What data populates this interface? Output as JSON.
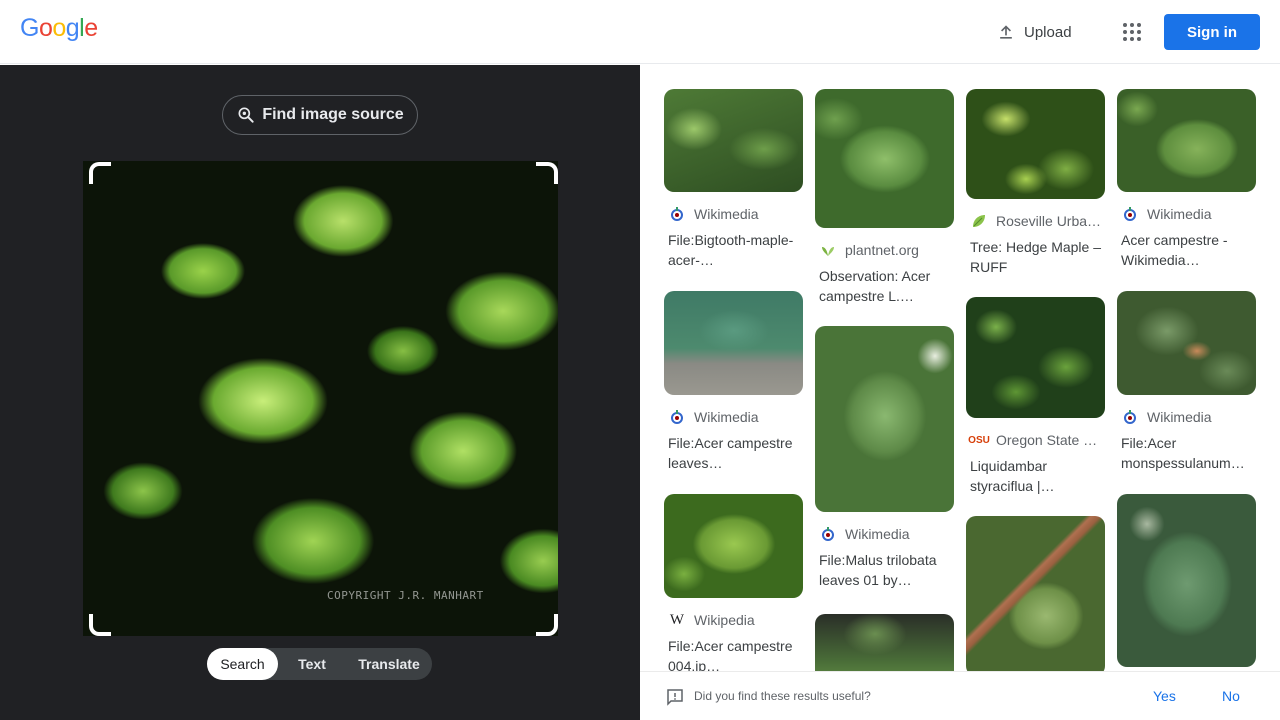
{
  "header": {
    "logo": {
      "letters": [
        "G",
        "o",
        "o",
        "g",
        "l",
        "e"
      ],
      "colors": [
        "#4285F4",
        "#EA4335",
        "#FBBC05",
        "#4285F4",
        "#34A853",
        "#EA4335"
      ]
    },
    "upload_label": "Upload",
    "signin_label": "Sign in",
    "signin_color": "#1a73e8"
  },
  "left_panel": {
    "find_source_label": "Find image source",
    "watermark_text": "COPYRIGHT J.R. MANHART",
    "tabs": [
      {
        "label": "Search",
        "active": true
      },
      {
        "label": "Text",
        "active": false
      },
      {
        "label": "Translate",
        "active": false
      }
    ]
  },
  "results": [
    {
      "source": "Wikimedia",
      "favicon": "wikimedia-icon",
      "title": "File:Bigtooth-maple-acer-…"
    },
    {
      "source": "plantnet.org",
      "favicon": "plantnet-icon",
      "title": "Observation: Acer campestre L.…"
    },
    {
      "source": "Roseville Urba…",
      "favicon": "leaf-icon",
      "title": "Tree: Hedge Maple – RUFF"
    },
    {
      "source": "Wikimedia",
      "favicon": "wikimedia-icon",
      "title": "Acer campestre - Wikimedia…"
    },
    {
      "source": "Wikimedia",
      "favicon": "wikimedia-icon",
      "title": "File:Acer campestre leaves…"
    },
    {
      "source": "Wikimedia",
      "favicon": "wikimedia-icon",
      "title": "File:Malus trilobata leaves 01 by…"
    },
    {
      "source": "Oregon State …",
      "favicon": "osu-icon",
      "title": "Liquidambar styraciflua |…"
    },
    {
      "source": "Wikimedia",
      "favicon": "wikimedia-icon",
      "title": "File:Acer monspessulanum…"
    },
    {
      "source": "Wikipedia",
      "favicon": "wikipedia-icon",
      "title": "File:Acer campestre 004.jp…"
    },
    {
      "source": "",
      "favicon": "",
      "title": ""
    },
    {
      "source": "",
      "favicon": "",
      "title": ""
    },
    {
      "source": "",
      "favicon": "",
      "title": ""
    }
  ],
  "feedback": {
    "question": "Did you find these results useful?",
    "yes_label": "Yes",
    "no_label": "No"
  }
}
